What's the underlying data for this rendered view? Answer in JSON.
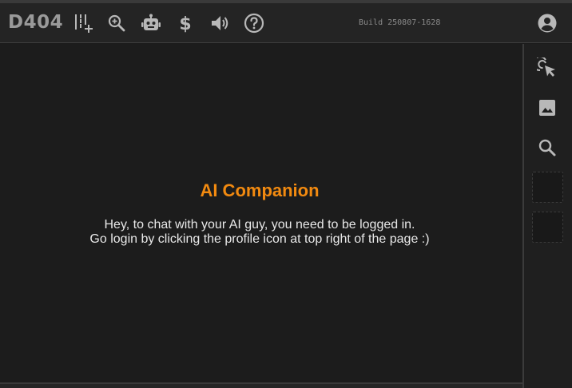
{
  "header": {
    "logo": "D404",
    "build_label": "Build 250807-1628",
    "icons": [
      "columns-add-icon",
      "zoom-in-icon",
      "robot-icon",
      "dollar-icon",
      "volume-icon",
      "help-icon",
      "account-icon"
    ]
  },
  "main": {
    "title": "AI Companion",
    "message_line1": "Hey, to chat with your AI guy, you need to be logged in.",
    "message_line2": "Go login by clicking the profile icon at top right of the page :)"
  },
  "right_panel": {
    "icons": [
      "cursor-click-icon",
      "image-icon",
      "search-icon"
    ],
    "empty_slots": 2
  },
  "colors": {
    "accent": "#f28a10",
    "background": "#1c1c1c",
    "topbar": "#242424",
    "icon": "#b8b8b8"
  }
}
